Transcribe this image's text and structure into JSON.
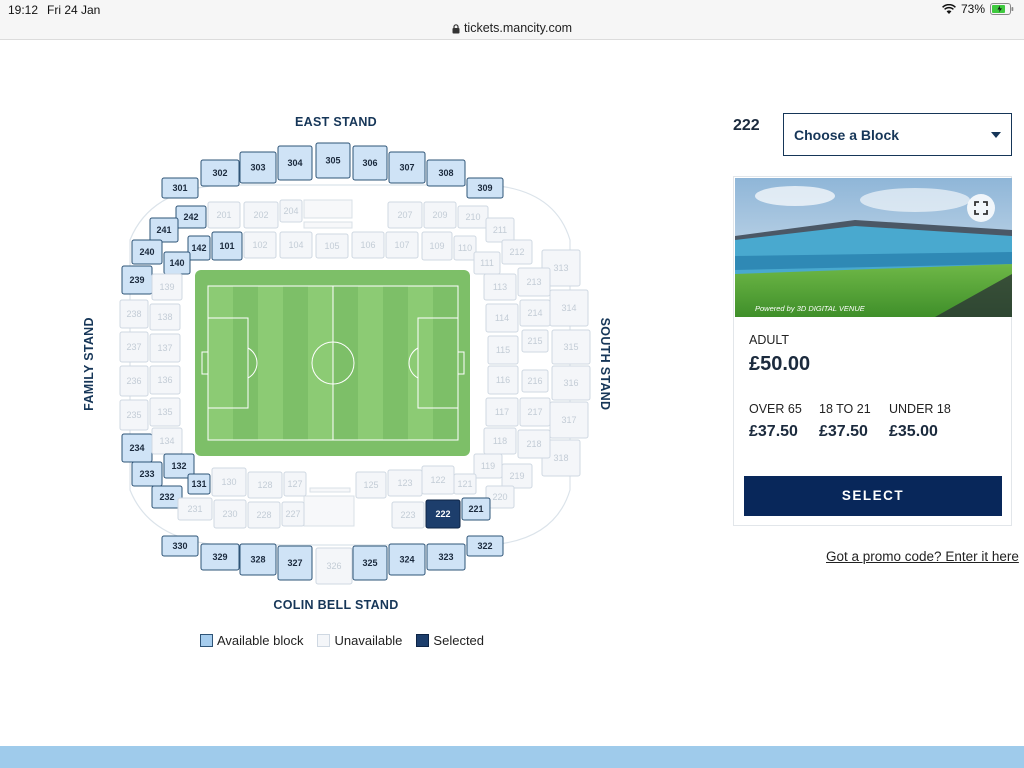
{
  "status": {
    "time": "19:12",
    "date": "Fri 24 Jan",
    "battery": "73%"
  },
  "browser": {
    "url": "tickets.mancity.com"
  },
  "stands": {
    "east": "EAST STAND",
    "south": "SOUTH STAND",
    "family": "FAMILY STAND",
    "colin_bell": "COLIN BELL STAND"
  },
  "sections": {
    "east_upper": [
      {
        "label": "301",
        "status": "available"
      },
      {
        "label": "302",
        "status": "available"
      },
      {
        "label": "303",
        "status": "available"
      },
      {
        "label": "304",
        "status": "available"
      },
      {
        "label": "305",
        "status": "available"
      },
      {
        "label": "306",
        "status": "available"
      },
      {
        "label": "307",
        "status": "available"
      },
      {
        "label": "308",
        "status": "available"
      },
      {
        "label": "309",
        "status": "available"
      }
    ],
    "east_middle": [
      {
        "label": "242",
        "status": "available"
      },
      {
        "label": "201",
        "status": "unavailable"
      },
      {
        "label": "202",
        "status": "unavailable"
      },
      {
        "label": "204",
        "status": "unavailable"
      },
      {
        "label": "207",
        "status": "unavailable"
      },
      {
        "label": "209",
        "status": "unavailable"
      },
      {
        "label": "210",
        "status": "unavailable"
      }
    ],
    "east_lower": [
      {
        "label": "142",
        "status": "available"
      },
      {
        "label": "101",
        "status": "available"
      },
      {
        "label": "102",
        "status": "unavailable"
      },
      {
        "label": "104",
        "status": "unavailable"
      },
      {
        "label": "105",
        "status": "unavailable"
      },
      {
        "label": "106",
        "status": "unavailable"
      },
      {
        "label": "107",
        "status": "unavailable"
      },
      {
        "label": "109",
        "status": "unavailable"
      },
      {
        "label": "110",
        "status": "unavailable"
      }
    ],
    "ne_corner": [
      {
        "label": "211",
        "status": "unavailable"
      },
      {
        "label": "212",
        "status": "unavailable"
      },
      {
        "label": "111",
        "status": "unavailable"
      }
    ],
    "nw_corner": [
      {
        "label": "241",
        "status": "available"
      },
      {
        "label": "240",
        "status": "available"
      },
      {
        "label": "140",
        "status": "available"
      }
    ],
    "family_middle": [
      {
        "label": "239",
        "status": "available"
      },
      {
        "label": "238",
        "status": "unavailable"
      },
      {
        "label": "237",
        "status": "unavailable"
      },
      {
        "label": "236",
        "status": "unavailable"
      },
      {
        "label": "235",
        "status": "unavailable"
      },
      {
        "label": "234",
        "status": "available"
      }
    ],
    "family_lower": [
      {
        "label": "139",
        "status": "unavailable"
      },
      {
        "label": "138",
        "status": "unavailable"
      },
      {
        "label": "137",
        "status": "unavailable"
      },
      {
        "label": "136",
        "status": "unavailable"
      },
      {
        "label": "135",
        "status": "unavailable"
      },
      {
        "label": "134",
        "status": "unavailable"
      }
    ],
    "south_upper": [
      {
        "label": "313",
        "status": "unavailable"
      },
      {
        "label": "314",
        "status": "unavailable"
      },
      {
        "label": "315",
        "status": "unavailable"
      },
      {
        "label": "316",
        "status": "unavailable"
      },
      {
        "label": "317",
        "status": "unavailable"
      },
      {
        "label": "318",
        "status": "unavailable"
      }
    ],
    "south_middle": [
      {
        "label": "213",
        "status": "unavailable"
      },
      {
        "label": "214",
        "status": "unavailable"
      },
      {
        "label": "215",
        "status": "unavailable"
      },
      {
        "label": "216",
        "status": "unavailable"
      },
      {
        "label": "217",
        "status": "unavailable"
      },
      {
        "label": "218",
        "status": "unavailable"
      }
    ],
    "south_lower": [
      {
        "label": "113",
        "status": "unavailable"
      },
      {
        "label": "114",
        "status": "unavailable"
      },
      {
        "label": "115",
        "status": "unavailable"
      },
      {
        "label": "116",
        "status": "unavailable"
      },
      {
        "label": "117",
        "status": "unavailable"
      },
      {
        "label": "118",
        "status": "unavailable"
      }
    ],
    "sw_corner": [
      {
        "label": "233",
        "status": "available"
      },
      {
        "label": "232",
        "status": "available"
      },
      {
        "label": "132",
        "status": "available"
      },
      {
        "label": "131",
        "status": "available"
      }
    ],
    "se_corner": [
      {
        "label": "119",
        "status": "unavailable"
      },
      {
        "label": "219",
        "status": "unavailable"
      },
      {
        "label": "220",
        "status": "unavailable"
      },
      {
        "label": "121",
        "status": "unavailable"
      }
    ],
    "west_lower": [
      {
        "label": "130",
        "status": "unavailable"
      },
      {
        "label": "128",
        "status": "unavailable"
      },
      {
        "label": "127",
        "status": "unavailable"
      },
      {
        "label": "125",
        "status": "unavailable"
      },
      {
        "label": "123",
        "status": "unavailable"
      },
      {
        "label": "122",
        "status": "unavailable"
      }
    ],
    "west_middle": [
      {
        "label": "231",
        "status": "unavailable"
      },
      {
        "label": "230",
        "status": "unavailable"
      },
      {
        "label": "228",
        "status": "unavailable"
      },
      {
        "label": "227",
        "status": "unavailable"
      },
      {
        "label": "223",
        "status": "unavailable"
      },
      {
        "label": "222",
        "status": "selected"
      },
      {
        "label": "221",
        "status": "available"
      }
    ],
    "west_upper": [
      {
        "label": "330",
        "status": "available"
      },
      {
        "label": "329",
        "status": "available"
      },
      {
        "label": "328",
        "status": "available"
      },
      {
        "label": "327",
        "status": "available"
      },
      {
        "label": "326",
        "status": "unavailable"
      },
      {
        "label": "325",
        "status": "available"
      },
      {
        "label": "324",
        "status": "available"
      },
      {
        "label": "323",
        "status": "available"
      },
      {
        "label": "322",
        "status": "available"
      }
    ]
  },
  "legend": {
    "available": "Available block",
    "unavailable": "Unavailable",
    "selected": "Selected"
  },
  "panel": {
    "selected_block": "222",
    "block_select_label": "Choose a Block",
    "view_credit": "Powered by 3D DIGITAL VENUE",
    "adult_label": "ADULT",
    "adult_price": "£50.00",
    "tiers": [
      {
        "label": "OVER 65",
        "price": "£37.50"
      },
      {
        "label": "18 TO 21",
        "price": "£37.50"
      },
      {
        "label": "UNDER 18",
        "price": "£35.00"
      }
    ],
    "select_label": "SELECT",
    "promo": "Got a promo code? Enter it here"
  },
  "colors": {
    "available": "#cfe3f6",
    "unavailable": "#f4f6f9",
    "selected": "#1d3e6c",
    "primary": "#08275a"
  }
}
